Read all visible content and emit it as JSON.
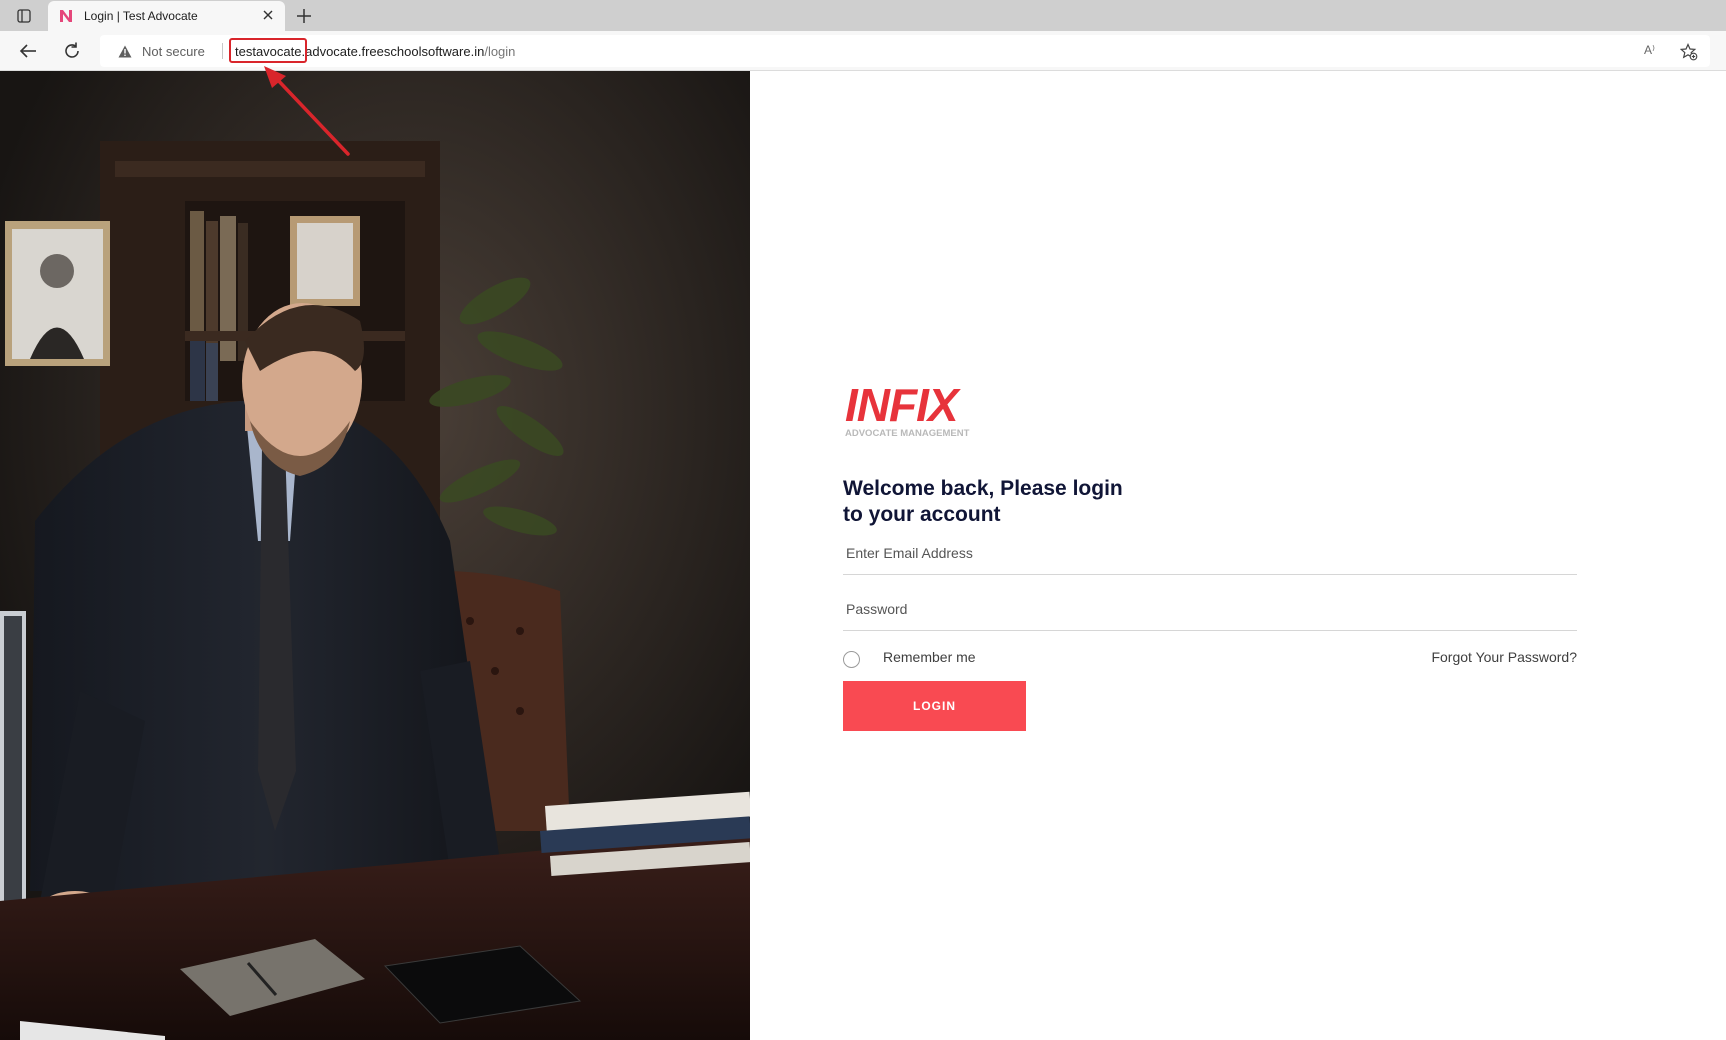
{
  "browser": {
    "tab_title": "Login | Test Advocate",
    "security_label": "Not secure",
    "url_subdomain": "testavocate",
    "url_domain": ".advocate.freeschoolsoftware.in",
    "url_path": "/login",
    "read_aloud_label": "A⁾"
  },
  "logo": {
    "wordmark": "INFIX",
    "tagline": "ADVOCATE MANAGEMENT"
  },
  "login": {
    "heading_line1": "Welcome back, Please login",
    "heading_line2": "to your account",
    "email_placeholder": "Enter Email Address",
    "password_placeholder": "Password",
    "remember_label": "Remember me",
    "forgot_label": "Forgot Your Password?",
    "login_label": "LOGIN"
  },
  "colors": {
    "accent": "#f94a52",
    "heading": "#101536",
    "annotation": "#d9252b"
  }
}
